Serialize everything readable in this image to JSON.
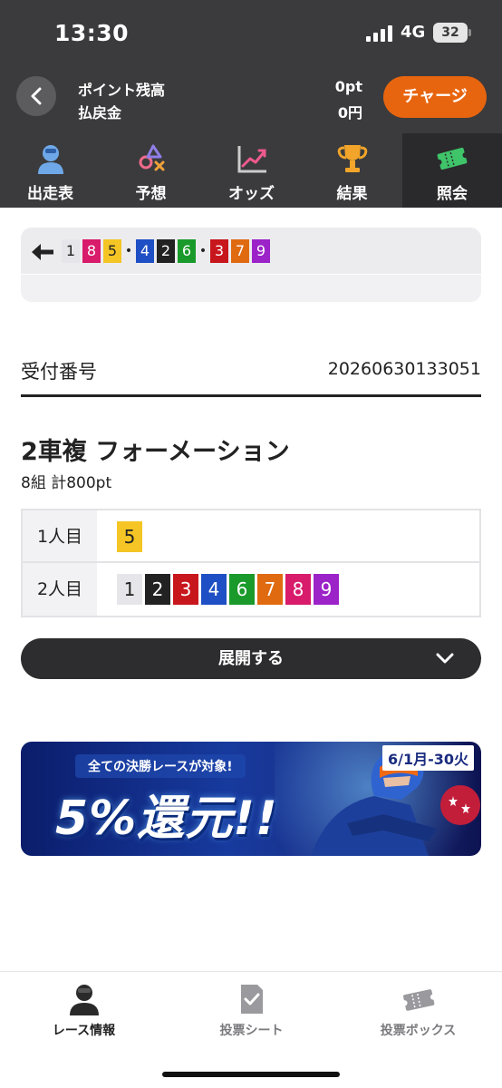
{
  "status_bar": {
    "time": "13:30",
    "network": "4G",
    "battery": "32"
  },
  "header": {
    "point_label": "ポイント残高",
    "refund_label": "払戻金",
    "point_value": "0pt",
    "refund_value": "0円",
    "charge_label": "チャージ"
  },
  "nav": {
    "items": [
      {
        "label": "出走表",
        "icon": "rider-avatar-icon"
      },
      {
        "label": "予想",
        "icon": "prediction-symbols-icon"
      },
      {
        "label": "オッズ",
        "icon": "chart-trend-icon"
      },
      {
        "label": "結果",
        "icon": "trophy-icon"
      },
      {
        "label": "照会",
        "icon": "ticket-icon",
        "active": true
      }
    ]
  },
  "number_strip": {
    "items": [
      {
        "text": "1",
        "color": "#e6e6ea",
        "fg": "#222222"
      },
      {
        "text": "8",
        "color": "#d81b6a",
        "fg": "#ffffff"
      },
      {
        "text": "5",
        "color": "#f4c524",
        "fg": "#222222"
      },
      {
        "text": "•",
        "dot": true
      },
      {
        "text": "4",
        "color": "#1f4fc4",
        "fg": "#ffffff"
      },
      {
        "text": "2",
        "color": "#222222",
        "fg": "#ffffff"
      },
      {
        "text": "6",
        "color": "#1a9a2a",
        "fg": "#ffffff"
      },
      {
        "text": "•",
        "dot": true
      },
      {
        "text": "3",
        "color": "#c8161d",
        "fg": "#ffffff"
      },
      {
        "text": "7",
        "color": "#e06a10",
        "fg": "#ffffff"
      },
      {
        "text": "9",
        "color": "#9b23c8",
        "fg": "#ffffff"
      }
    ]
  },
  "receipt": {
    "label": "受付番号",
    "value": "20260630133051"
  },
  "bet": {
    "title": "2車複 フォーメーション",
    "summary": "8組 計800pt",
    "rows": [
      {
        "head": "1人目",
        "nums": [
          {
            "text": "5",
            "color": "#f4c524",
            "fg": "#222222"
          }
        ]
      },
      {
        "head": "2人目",
        "nums": [
          {
            "text": "1",
            "color": "#e6e6ea",
            "fg": "#222222"
          },
          {
            "text": "2",
            "color": "#222222",
            "fg": "#ffffff"
          },
          {
            "text": "3",
            "color": "#c8161d",
            "fg": "#ffffff"
          },
          {
            "text": "4",
            "color": "#1f4fc4",
            "fg": "#ffffff"
          },
          {
            "text": "6",
            "color": "#1a9a2a",
            "fg": "#ffffff"
          },
          {
            "text": "7",
            "color": "#e06a10",
            "fg": "#ffffff"
          },
          {
            "text": "8",
            "color": "#d81b6a",
            "fg": "#ffffff"
          },
          {
            "text": "9",
            "color": "#9b23c8",
            "fg": "#ffffff"
          }
        ]
      }
    ],
    "expand_label": "展開する"
  },
  "banner": {
    "sub": "全ての決勝レースが対象!",
    "main": "5%還元!!",
    "date": "6/1月-30火"
  },
  "tabbar": {
    "items": [
      {
        "label": "レース情報",
        "icon": "race-info-icon",
        "active": true
      },
      {
        "label": "投票シート",
        "icon": "bet-sheet-icon"
      },
      {
        "label": "投票ボックス",
        "icon": "bet-box-icon"
      }
    ]
  },
  "colors": {
    "accent": "#e8650f",
    "header_bg": "#3b3b3d"
  }
}
